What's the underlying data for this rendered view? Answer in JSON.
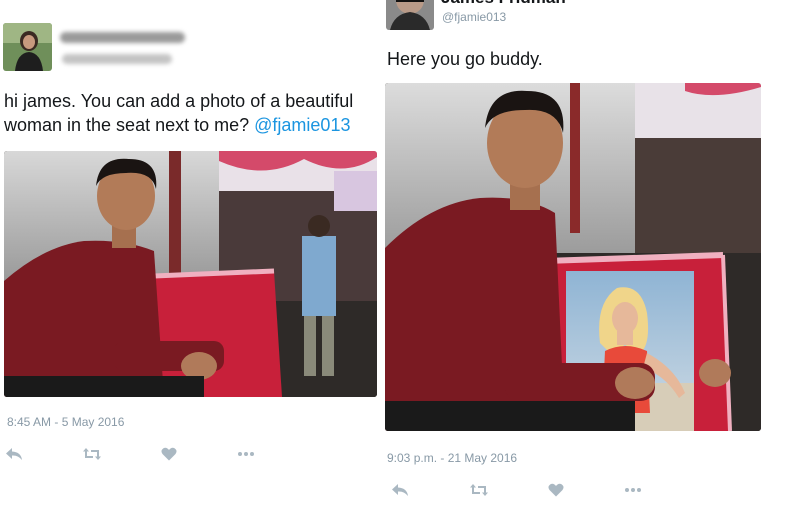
{
  "colors": {
    "text": "#14171a",
    "muted": "#8899a6",
    "mention": "#1b95e0",
    "icon": "#aab8c2"
  },
  "left_tweet": {
    "text_before_mention": "hi james. You can add a photo of a beautiful woman in the seat next to me? ",
    "mention": "@fjamie013",
    "timestamp": "8:45 AM - 5 May 2016",
    "actions": [
      "reply-icon",
      "retweet-icon",
      "like-icon",
      "more-icon"
    ]
  },
  "right_tweet": {
    "display_name": "James Fridman",
    "handle": "@fjamie013",
    "text": "Here you go buddy.",
    "timestamp": "9:03 p.m. - 21 May 2016",
    "actions": [
      "reply-icon",
      "retweet-icon",
      "like-icon",
      "more-icon"
    ]
  }
}
